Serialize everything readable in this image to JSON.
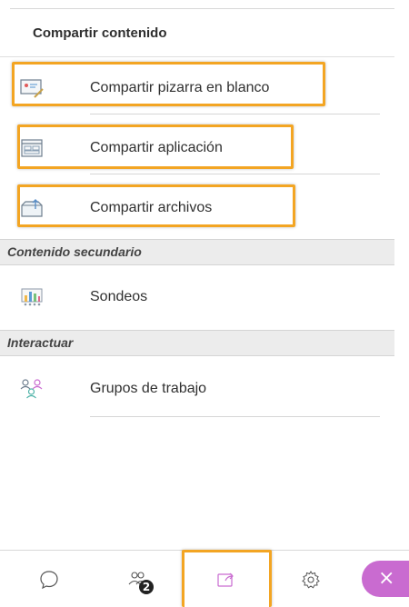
{
  "panel": {
    "title": "Compartir contenido",
    "items": [
      {
        "label": "Compartir pizarra en blanco",
        "icon": "whiteboard-icon"
      },
      {
        "label": "Compartir aplicación",
        "icon": "application-window-icon"
      },
      {
        "label": "Compartir archivos",
        "icon": "file-folder-icon"
      }
    ],
    "secondary_section": "Contenido secundario",
    "secondary_items": [
      {
        "label": "Sondeos",
        "icon": "polls-chart-icon"
      }
    ],
    "interact_section": "Interactuar",
    "interact_items": [
      {
        "label": "Grupos de trabajo",
        "icon": "breakout-groups-icon"
      }
    ]
  },
  "bottombar": {
    "chat_icon": "chat-bubble-icon",
    "attendees_icon": "attendees-icon",
    "attendees_badge": "2",
    "share_icon": "share-content-icon",
    "settings_icon": "gear-icon",
    "close_label": "×"
  },
  "colors": {
    "highlight": "#f3a523",
    "accent": "#c96bd0",
    "section_bg": "#ececec"
  }
}
